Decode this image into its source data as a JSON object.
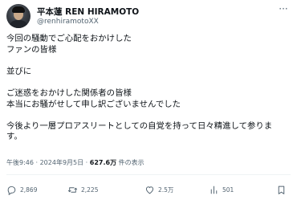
{
  "post": {
    "display_name": "平本蓮 REN HIRAMOTO",
    "handle": "@renhiramotoXX",
    "text_lines": [
      "今回の騒動でご心配をおかけした",
      "ファンの皆様",
      "",
      "並びに",
      "",
      "ご迷惑をおかけした関係者の皆様",
      "本当にお騒がせして申し訳ございませんでした",
      "",
      "今後より一層プロアスリートとしての自覚を持って日々精進して参りま",
      "す。"
    ],
    "timestamp": "午後9:46 · 2024年9月5日 · ",
    "views_count": "627.6万",
    "views_suffix": " 件の表示"
  },
  "actions": {
    "replies": "2,869",
    "reposts": "2,225",
    "likes": "2.5万",
    "views": "501"
  },
  "icons": {
    "more": "more-horizontal-icon",
    "reply": "reply-icon",
    "repost": "repost-icon",
    "like": "heart-icon",
    "views": "bar-chart-icon",
    "bookmark": "bookmark-icon"
  },
  "colors": {
    "text": "#0f1419",
    "secondary": "#536471",
    "divider": "#eff3f4"
  }
}
